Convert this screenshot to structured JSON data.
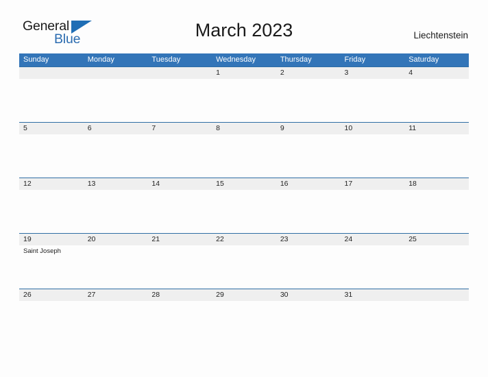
{
  "brand": {
    "name_part1": "General",
    "name_part2": "Blue",
    "triangle_icon": "triangle-icon",
    "accent_dark": "#1a1a1a",
    "accent_blue": "#2b6cb0"
  },
  "header": {
    "title": "March 2023",
    "region": "Liechtenstein"
  },
  "colors": {
    "header_blue": "#3375b8",
    "row_divider_blue": "#2e6da4",
    "daynum_band_gray": "#efefef",
    "page_background": "#fdfdfd",
    "text_dark": "#222222"
  },
  "calendar": {
    "weekdays": [
      "Sunday",
      "Monday",
      "Tuesday",
      "Wednesday",
      "Thursday",
      "Friday",
      "Saturday"
    ],
    "weeks": [
      {
        "days": [
          {
            "num": "",
            "events": []
          },
          {
            "num": "",
            "events": []
          },
          {
            "num": "",
            "events": []
          },
          {
            "num": "1",
            "events": []
          },
          {
            "num": "2",
            "events": []
          },
          {
            "num": "3",
            "events": []
          },
          {
            "num": "4",
            "events": []
          }
        ]
      },
      {
        "days": [
          {
            "num": "5",
            "events": []
          },
          {
            "num": "6",
            "events": []
          },
          {
            "num": "7",
            "events": []
          },
          {
            "num": "8",
            "events": []
          },
          {
            "num": "9",
            "events": []
          },
          {
            "num": "10",
            "events": []
          },
          {
            "num": "11",
            "events": []
          }
        ]
      },
      {
        "days": [
          {
            "num": "12",
            "events": []
          },
          {
            "num": "13",
            "events": []
          },
          {
            "num": "14",
            "events": []
          },
          {
            "num": "15",
            "events": []
          },
          {
            "num": "16",
            "events": []
          },
          {
            "num": "17",
            "events": []
          },
          {
            "num": "18",
            "events": []
          }
        ]
      },
      {
        "days": [
          {
            "num": "19",
            "events": [
              "Saint Joseph"
            ]
          },
          {
            "num": "20",
            "events": []
          },
          {
            "num": "21",
            "events": []
          },
          {
            "num": "22",
            "events": []
          },
          {
            "num": "23",
            "events": []
          },
          {
            "num": "24",
            "events": []
          },
          {
            "num": "25",
            "events": []
          }
        ]
      },
      {
        "days": [
          {
            "num": "26",
            "events": []
          },
          {
            "num": "27",
            "events": []
          },
          {
            "num": "28",
            "events": []
          },
          {
            "num": "29",
            "events": []
          },
          {
            "num": "30",
            "events": []
          },
          {
            "num": "31",
            "events": []
          },
          {
            "num": "",
            "events": []
          }
        ]
      }
    ]
  }
}
